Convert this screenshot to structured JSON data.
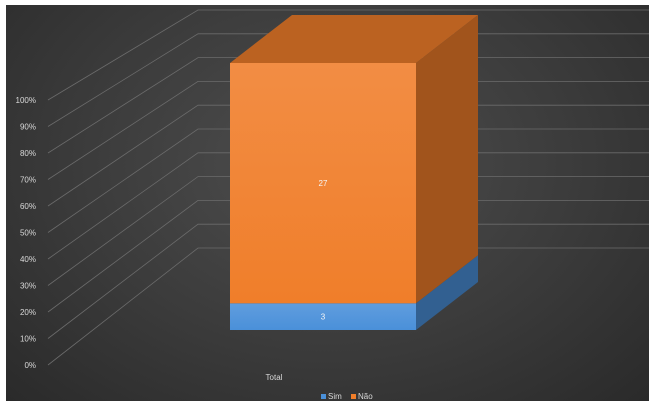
{
  "chart_data": {
    "type": "bar",
    "stacked": "percent",
    "three_d": true,
    "categories": [
      "Total"
    ],
    "series": [
      {
        "name": "Sim",
        "values": [
          3
        ],
        "color": "#4a90d9"
      },
      {
        "name": "Não",
        "values": [
          27
        ],
        "color": "#f07e2a"
      }
    ],
    "ylim": [
      0,
      100
    ],
    "y_ticks": [
      "0%",
      "10%",
      "20%",
      "30%",
      "40%",
      "50%",
      "60%",
      "70%",
      "80%",
      "90%",
      "100%"
    ],
    "grid": true,
    "legend_position": "bottom",
    "background_color": "#3a3a3a"
  }
}
